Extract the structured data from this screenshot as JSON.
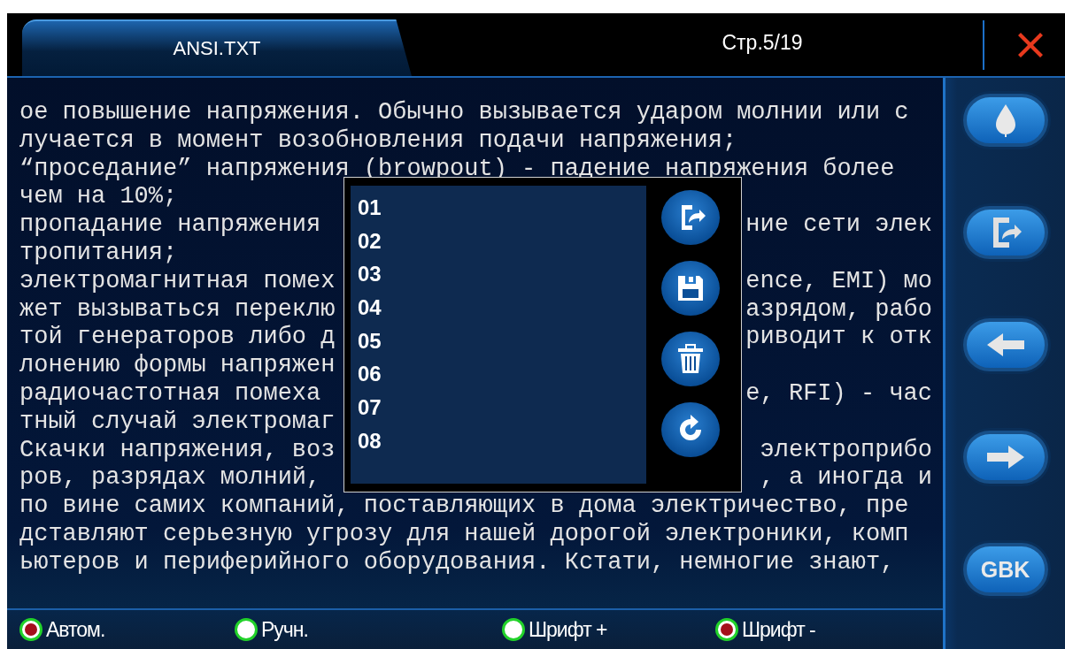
{
  "header": {
    "tab": {
      "label": "ANSI.TXT",
      "selected": true
    },
    "page": "Стр.5/19"
  },
  "text_lines": [
    {
      "left": "ое повышение напряжения. Обычно вызывается ударом молнии или с"
    },
    {
      "left": "лучается в момент возобновления подачи напряжения;"
    },
    {
      "left": "“проседание” напряжения (browpout) - падение напряжения более"
    },
    {
      "left": "чем на 10%;"
    },
    {
      "left": "пропадание напряжения",
      "right": "ние сети элек"
    },
    {
      "left": "тропитания;"
    },
    {
      "left": "электромагнитная помех",
      "right": "ence, EMI) мо"
    },
    {
      "left": "жет вызываться переклю",
      "right": "азрядом, рабо"
    },
    {
      "left": "той генераторов либо д",
      "right": "риводит к отк"
    },
    {
      "left": "лонению формы напряжен"
    },
    {
      "left": "радиочастотная помеха",
      "right": "e, RFI) - час"
    },
    {
      "left": "тный случай электромаг"
    },
    {
      "left": "Скачки напряжения, воз",
      "right": "электроприбо"
    },
    {
      "left": "ров, разрядах молний,",
      "right": ", а иногда и"
    },
    {
      "left": "по вине самих компаний, поставляющих в дома электричество, пре"
    },
    {
      "left": "дставляют серьезную угрозу для нашей дорогой электроники, комп"
    },
    {
      "left": "ьютеров и периферийного оборудования. Кстати, немногие знают,"
    }
  ],
  "popup": {
    "slots": [
      "01",
      "02",
      "03",
      "04",
      "05",
      "06",
      "07",
      "08"
    ],
    "buttons": [
      {
        "kind": "load"
      },
      {
        "kind": "save"
      },
      {
        "kind": "delete"
      },
      {
        "kind": "refresh"
      }
    ]
  },
  "sidebar_buttons": [
    {
      "kind": "drop"
    },
    {
      "kind": "export"
    },
    {
      "kind": "left"
    },
    {
      "kind": "right"
    },
    {
      "kind": "text",
      "label": "GBK"
    }
  ],
  "options": [
    {
      "label": "Автом.",
      "selected": true
    },
    {
      "label": "Ручн.",
      "selected": false
    },
    {
      "label": "Шрифт +",
      "selected": false
    },
    {
      "label": "Шрифт -",
      "selected": true
    }
  ]
}
